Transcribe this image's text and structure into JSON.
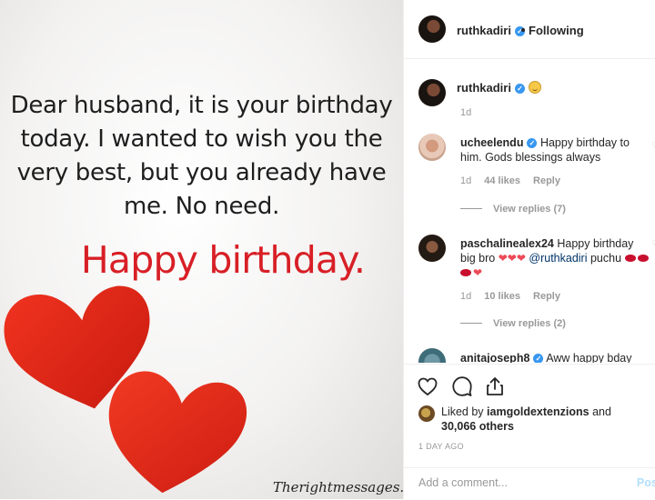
{
  "image": {
    "quote_lines": [
      "Dear husband, it is your birthday",
      "today. I wanted to wish you the",
      "very best, but you already have",
      "me. No need."
    ],
    "headline": "Happy birthday.",
    "watermark": "Therightmessages.com"
  },
  "header": {
    "username": "ruthkadiri",
    "following_label": "Following"
  },
  "caption": {
    "username": "ruthkadiri",
    "age": "1d"
  },
  "comments": [
    {
      "username": "ucheelendu",
      "text": "Happy birthday to him. Gods blessings always",
      "age": "1d",
      "likes": "44 likes",
      "reply_label": "Reply",
      "view_replies": "View replies (7)"
    },
    {
      "username": "paschalinealex24",
      "text_before": "Happy birthday big bro",
      "mention": "@ruthkadiri",
      "text_after": "puchu",
      "age": "1d",
      "likes": "10 likes",
      "reply_label": "Reply",
      "view_replies": "View replies (2)"
    },
    {
      "username": "anitajoseph8",
      "text": "Aww happy bday"
    }
  ],
  "likes": {
    "prefix": "Liked by",
    "user": "iamgoldextenzions",
    "conj": "and",
    "others": "30,066 others"
  },
  "date": "1 DAY AGO",
  "add_comment": {
    "placeholder": "Add a comment...",
    "post_label": "Post"
  },
  "icons": {
    "like": "heart-outline-icon",
    "comment": "comment-bubble-icon",
    "share": "share-icon",
    "verified": "verified-badge-icon"
  },
  "colors": {
    "headline_red": "#d81f26",
    "verified_blue": "#3897f0",
    "mention_blue": "#003569",
    "muted": "#999999"
  }
}
